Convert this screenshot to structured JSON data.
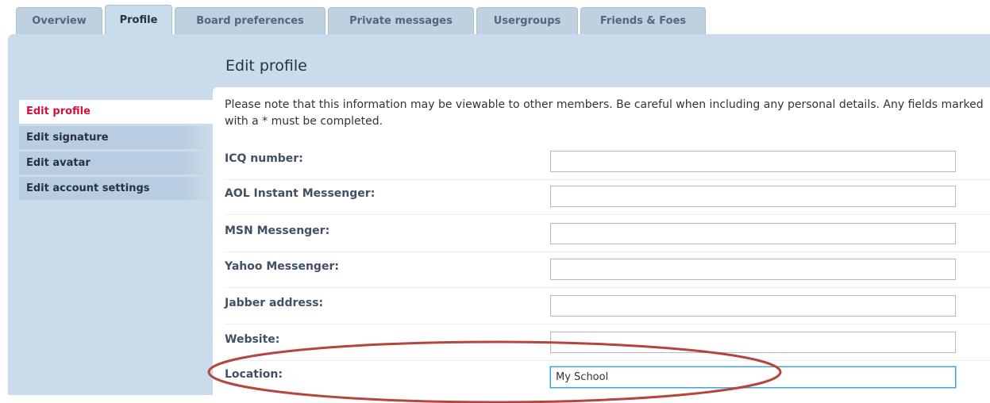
{
  "tabs": [
    {
      "label": "Overview",
      "active": false
    },
    {
      "label": "Profile",
      "active": true
    },
    {
      "label": "Board preferences",
      "active": false
    },
    {
      "label": "Private messages",
      "active": false
    },
    {
      "label": "Usergroups",
      "active": false
    },
    {
      "label": "Friends & Foes",
      "active": false
    }
  ],
  "page": {
    "title": "Edit profile"
  },
  "menu": {
    "items": [
      {
        "label": "Edit profile",
        "active": true
      },
      {
        "label": "Edit signature",
        "active": false
      },
      {
        "label": "Edit avatar",
        "active": false
      },
      {
        "label": "Edit account settings",
        "active": false
      }
    ]
  },
  "intro": "Please note that this information may be viewable to other members. Be careful when including any personal details. Any fields marked with a * must be completed.",
  "fields": [
    {
      "label": "ICQ number:",
      "value": ""
    },
    {
      "label": "AOL Instant Messenger:",
      "value": ""
    },
    {
      "label": "MSN Messenger:",
      "value": ""
    },
    {
      "label": "Yahoo Messenger:",
      "value": ""
    },
    {
      "label": "Jabber address:",
      "value": ""
    },
    {
      "label": "Website:",
      "value": ""
    },
    {
      "label": "Location:",
      "value": "My School"
    }
  ],
  "colors": {
    "panel": "#cadceb",
    "active_menu_text": "#d31141",
    "annotation": "#b5453e"
  }
}
